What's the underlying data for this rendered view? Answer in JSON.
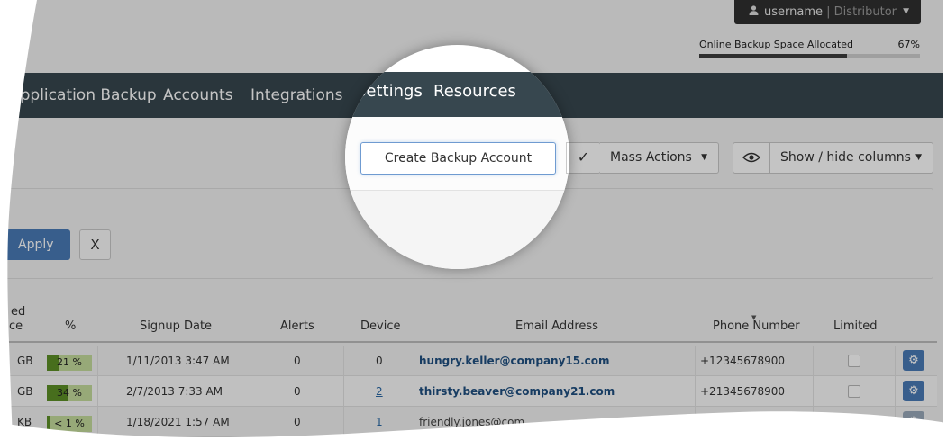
{
  "user_menu": {
    "username": "username",
    "separator": "|",
    "role": "Distributor"
  },
  "quota": {
    "label": "Online Backup Space Allocated",
    "percent_text": "67%",
    "percent": 67
  },
  "nav": {
    "items": [
      {
        "label": "Application Backup"
      },
      {
        "label": "Accounts"
      },
      {
        "label": "Integrations"
      },
      {
        "label": "Settings"
      },
      {
        "label": "Resources"
      }
    ]
  },
  "toolbar": {
    "create_label": "Create Backup Account",
    "mass_actions_label": "Mass Actions",
    "columns_label": "Show / hide columns"
  },
  "filter": {
    "apply_label": "Apply",
    "clear_label": "X"
  },
  "table": {
    "columns": {
      "space_line1": "ed",
      "space_line2": "ce",
      "percent": "%",
      "signup_date": "Signup Date",
      "alerts": "Alerts",
      "device": "Device",
      "email": "Email Address",
      "phone": "Phone Number",
      "limited": "Limited"
    },
    "rows": [
      {
        "space": "GB",
        "percent_text": "21 %",
        "percent": 21,
        "signup": "1/11/2013 3:47 AM",
        "alerts": "0",
        "device": "0",
        "device_link": false,
        "email": "hungry.keller@company15.com",
        "email_bold": true,
        "phone": "+12345678900"
      },
      {
        "space": "GB",
        "percent_text": "34 %",
        "percent": 34,
        "signup": "2/7/2013 7:33 AM",
        "alerts": "0",
        "device": "2",
        "device_link": true,
        "email": "thirsty.beaver@company21.com",
        "email_bold": true,
        "phone": "+21345678900"
      },
      {
        "space": "KB",
        "percent_text": "< 1 %",
        "percent": 1,
        "signup": "1/18/2021 1:57 AM",
        "alerts": "0",
        "device": "1",
        "device_link": true,
        "email": "friendly.jones@com",
        "email_bold": false,
        "phone": ""
      }
    ]
  }
}
